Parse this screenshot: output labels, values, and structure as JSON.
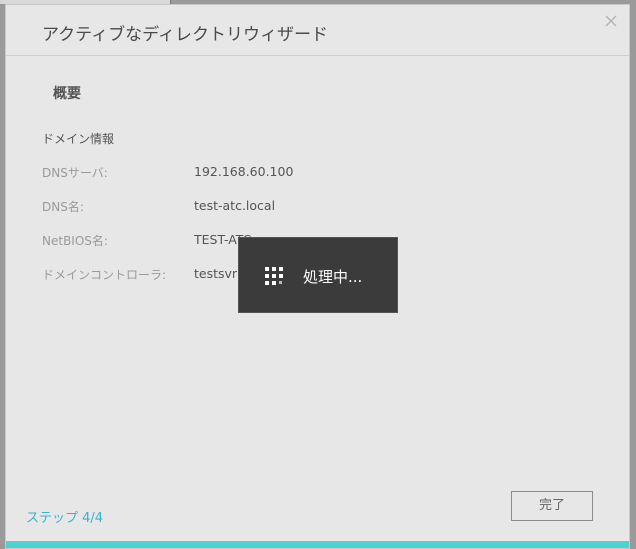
{
  "dialog": {
    "title": "アクティブなディレクトリウィザード",
    "close_icon": "close-icon",
    "section_title": "概要",
    "group_title": "ドメイン情報",
    "rows": [
      {
        "label": "DNSサーバ:",
        "value": "192.168.60.100"
      },
      {
        "label": "DNS名:",
        "value": "test-atc.local"
      },
      {
        "label": "NetBIOS名:",
        "value": "TEST-ATC"
      },
      {
        "label": "ドメインコントローラ:",
        "value": "testsvr"
      }
    ],
    "step_text": "ステップ 4/4",
    "done_label": "完了",
    "progress": 1.0,
    "accent_color": "#4fd1d1",
    "step_color": "#3ab3d0"
  },
  "overlay": {
    "text": "処理中...",
    "icon": "loading-grid-icon"
  }
}
